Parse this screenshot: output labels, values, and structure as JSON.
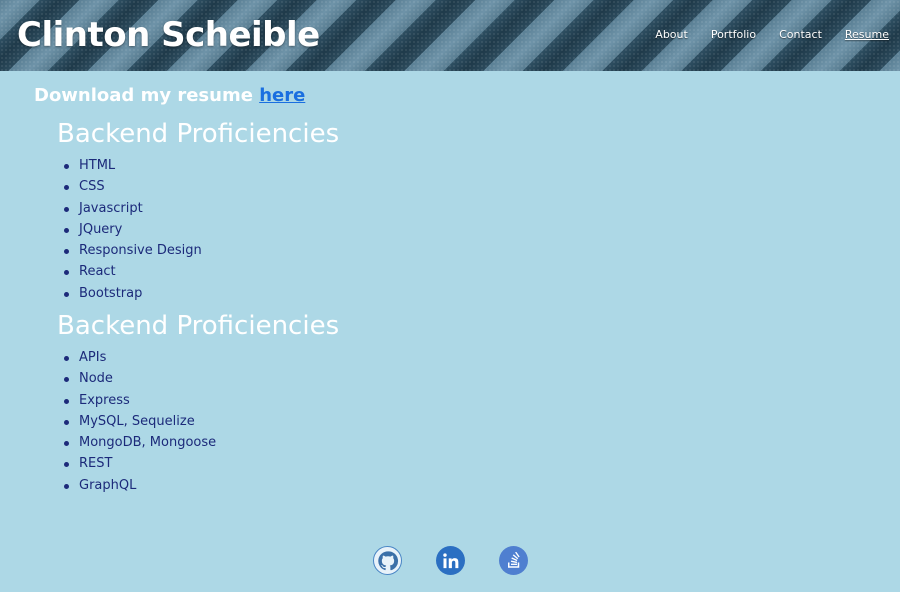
{
  "header": {
    "title": "Clinton Scheible",
    "nav": [
      {
        "label": "About",
        "active": false
      },
      {
        "label": "Portfolio",
        "active": false
      },
      {
        "label": "Contact",
        "active": false
      },
      {
        "label": "Resume",
        "active": true
      }
    ]
  },
  "download": {
    "text": "Download my resume ",
    "link_label": "here",
    "link_color": "#1a6fe0"
  },
  "sections": [
    {
      "title": "Backend Proficiencies",
      "items": [
        "HTML",
        "CSS",
        "Javascript",
        "JQuery",
        "Responsive Design",
        "React",
        "Bootstrap"
      ]
    },
    {
      "title": "Backend Proficiencies",
      "items": [
        "APIs",
        "Node",
        "Express",
        "MySQL, Sequelize",
        "MongoDB, Mongoose",
        "REST",
        "GraphQL"
      ]
    }
  ],
  "social": [
    {
      "icon": "github-icon"
    },
    {
      "icon": "linkedin-icon"
    },
    {
      "icon": "stackoverflow-icon"
    }
  ],
  "colors": {
    "background": "#add8e6",
    "list_text": "#1c2a7a",
    "heading_text": "#ffffff"
  }
}
